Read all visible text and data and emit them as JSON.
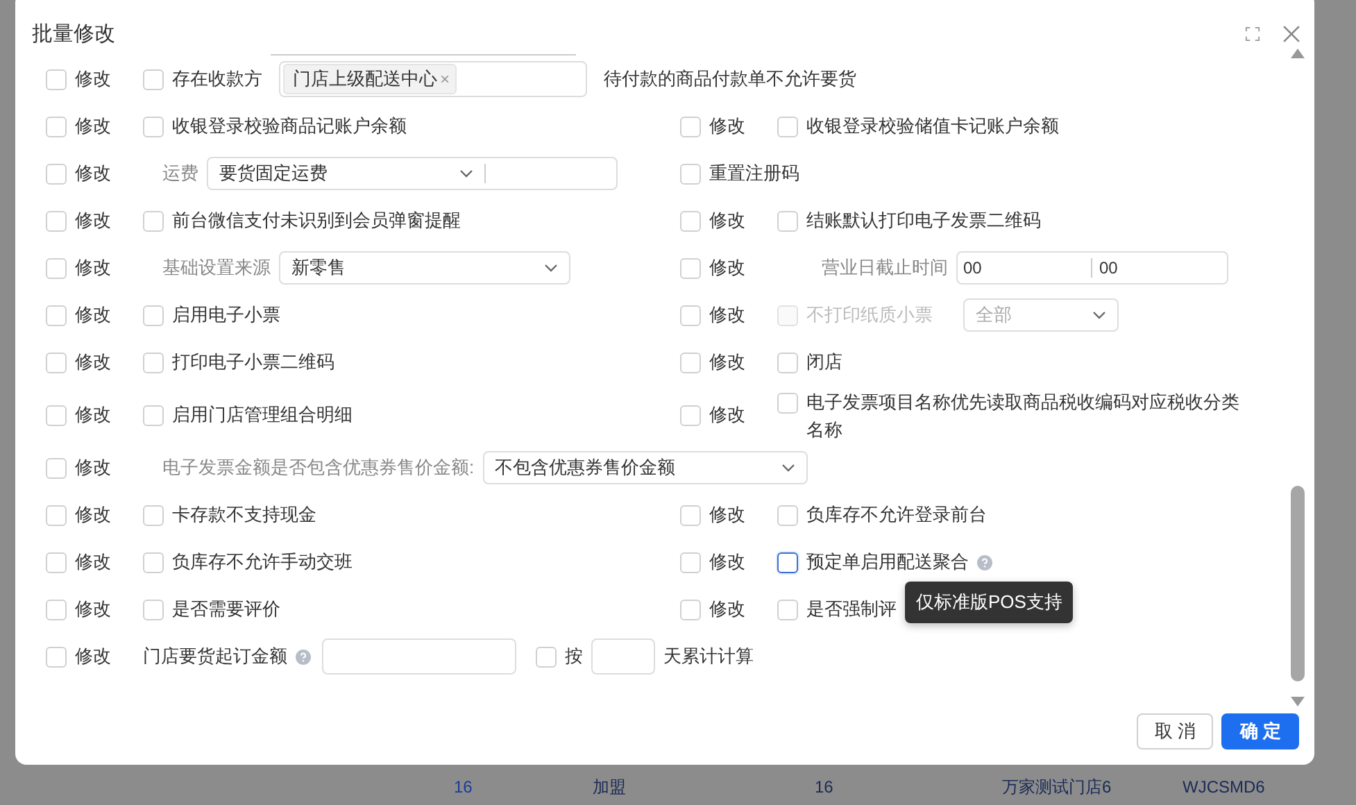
{
  "background_row": [
    "16",
    "加盟",
    "16",
    "万家测试门店6",
    "WJCSMD6"
  ],
  "dialog": {
    "title": "批量修改",
    "rows": [
      {
        "cells": [
          {
            "kind": "tags",
            "modify": "修改",
            "modify_checked": false,
            "checked": false,
            "label": "存在收款方",
            "tags": [
              {
                "text": "门店上级配送中心",
                "remove": "×"
              }
            ],
            "note": "待付款的商品付款单不允许要货"
          }
        ]
      },
      {
        "cells": [
          {
            "kind": "check",
            "modify": "修改",
            "modify_checked": false,
            "checked": false,
            "label": "收银登录校验商品记账户余额"
          },
          {
            "kind": "check",
            "modify": "修改",
            "modify_checked": false,
            "checked": false,
            "label": "收银登录校验储值卡记账户余额"
          }
        ]
      },
      {
        "cells": [
          {
            "kind": "select",
            "modify": "修改",
            "modify_checked": false,
            "label": "运费",
            "value": "要货固定运费",
            "extra_input": true
          },
          {
            "kind": "plain",
            "checked": false,
            "label": "重置注册码"
          }
        ]
      },
      {
        "cells": [
          {
            "kind": "check",
            "modify": "修改",
            "modify_checked": false,
            "checked": false,
            "label": "前台微信支付未识别到会员弹窗提醒"
          },
          {
            "kind": "check",
            "modify": "修改",
            "modify_checked": false,
            "checked": false,
            "label": "结账默认打印电子发票二维码"
          }
        ]
      },
      {
        "cells": [
          {
            "kind": "select",
            "modify": "修改",
            "modify_checked": false,
            "label": "基础设置来源",
            "value": "新零售",
            "extra_input": false
          },
          {
            "kind": "time",
            "modify": "修改",
            "modify_checked": false,
            "label": "营业日截止时间",
            "values": [
              "00",
              "00"
            ]
          }
        ]
      },
      {
        "cells": [
          {
            "kind": "check",
            "modify": "修改",
            "modify_checked": false,
            "checked": false,
            "label": "启用电子小票"
          },
          {
            "kind": "check-select",
            "modify": "修改",
            "modify_checked": false,
            "checked": false,
            "disabled": true,
            "label": "不打印纸质小票",
            "value": "全部"
          }
        ]
      },
      {
        "cells": [
          {
            "kind": "check",
            "modify": "修改",
            "modify_checked": false,
            "checked": false,
            "label": "打印电子小票二维码"
          },
          {
            "kind": "check",
            "modify": "修改",
            "modify_checked": false,
            "checked": false,
            "label": "闭店"
          }
        ]
      },
      {
        "cells": [
          {
            "kind": "check",
            "modify": "修改",
            "modify_checked": false,
            "checked": false,
            "label": "启用门店管理组合明细"
          },
          {
            "kind": "check",
            "modify": "修改",
            "modify_checked": false,
            "checked": false,
            "label": "电子发票项目名称优先读取商品税收编码对应税收分类名称"
          }
        ]
      },
      {
        "cells": [
          {
            "kind": "select",
            "modify": "修改",
            "modify_checked": false,
            "label": "电子发票金额是否包含优惠券售价金额:",
            "value": "不包含优惠券售价金额",
            "extra_input": false
          }
        ]
      },
      {
        "cells": [
          {
            "kind": "check",
            "modify": "修改",
            "modify_checked": false,
            "checked": false,
            "label": "卡存款不支持现金"
          },
          {
            "kind": "check",
            "modify": "修改",
            "modify_checked": false,
            "checked": false,
            "label": "负库存不允许登录前台"
          }
        ]
      },
      {
        "cells": [
          {
            "kind": "check",
            "modify": "修改",
            "modify_checked": false,
            "checked": false,
            "label": "负库存不允许手动交班"
          },
          {
            "kind": "check",
            "modify": "修改",
            "modify_checked": false,
            "checked": false,
            "focused": true,
            "label": "预定单启用配送聚合",
            "help": true,
            "tooltip": "仅标准版POS支持"
          }
        ]
      },
      {
        "cells": [
          {
            "kind": "check",
            "modify": "修改",
            "modify_checked": false,
            "checked": false,
            "label": "是否需要评价"
          },
          {
            "kind": "check",
            "modify": "修改",
            "modify_checked": false,
            "checked": false,
            "label": "是否强制评"
          }
        ]
      },
      {
        "cells": [
          {
            "kind": "amount",
            "modify": "修改",
            "modify_checked": false,
            "label": "门店要货起订金额",
            "help": true,
            "checked": false,
            "per_label": "按",
            "suffix": "天累计计算"
          }
        ]
      }
    ],
    "buttons": [
      {
        "label": "取 消",
        "kind": "default"
      },
      {
        "label": "确 定",
        "kind": "primary"
      }
    ]
  }
}
